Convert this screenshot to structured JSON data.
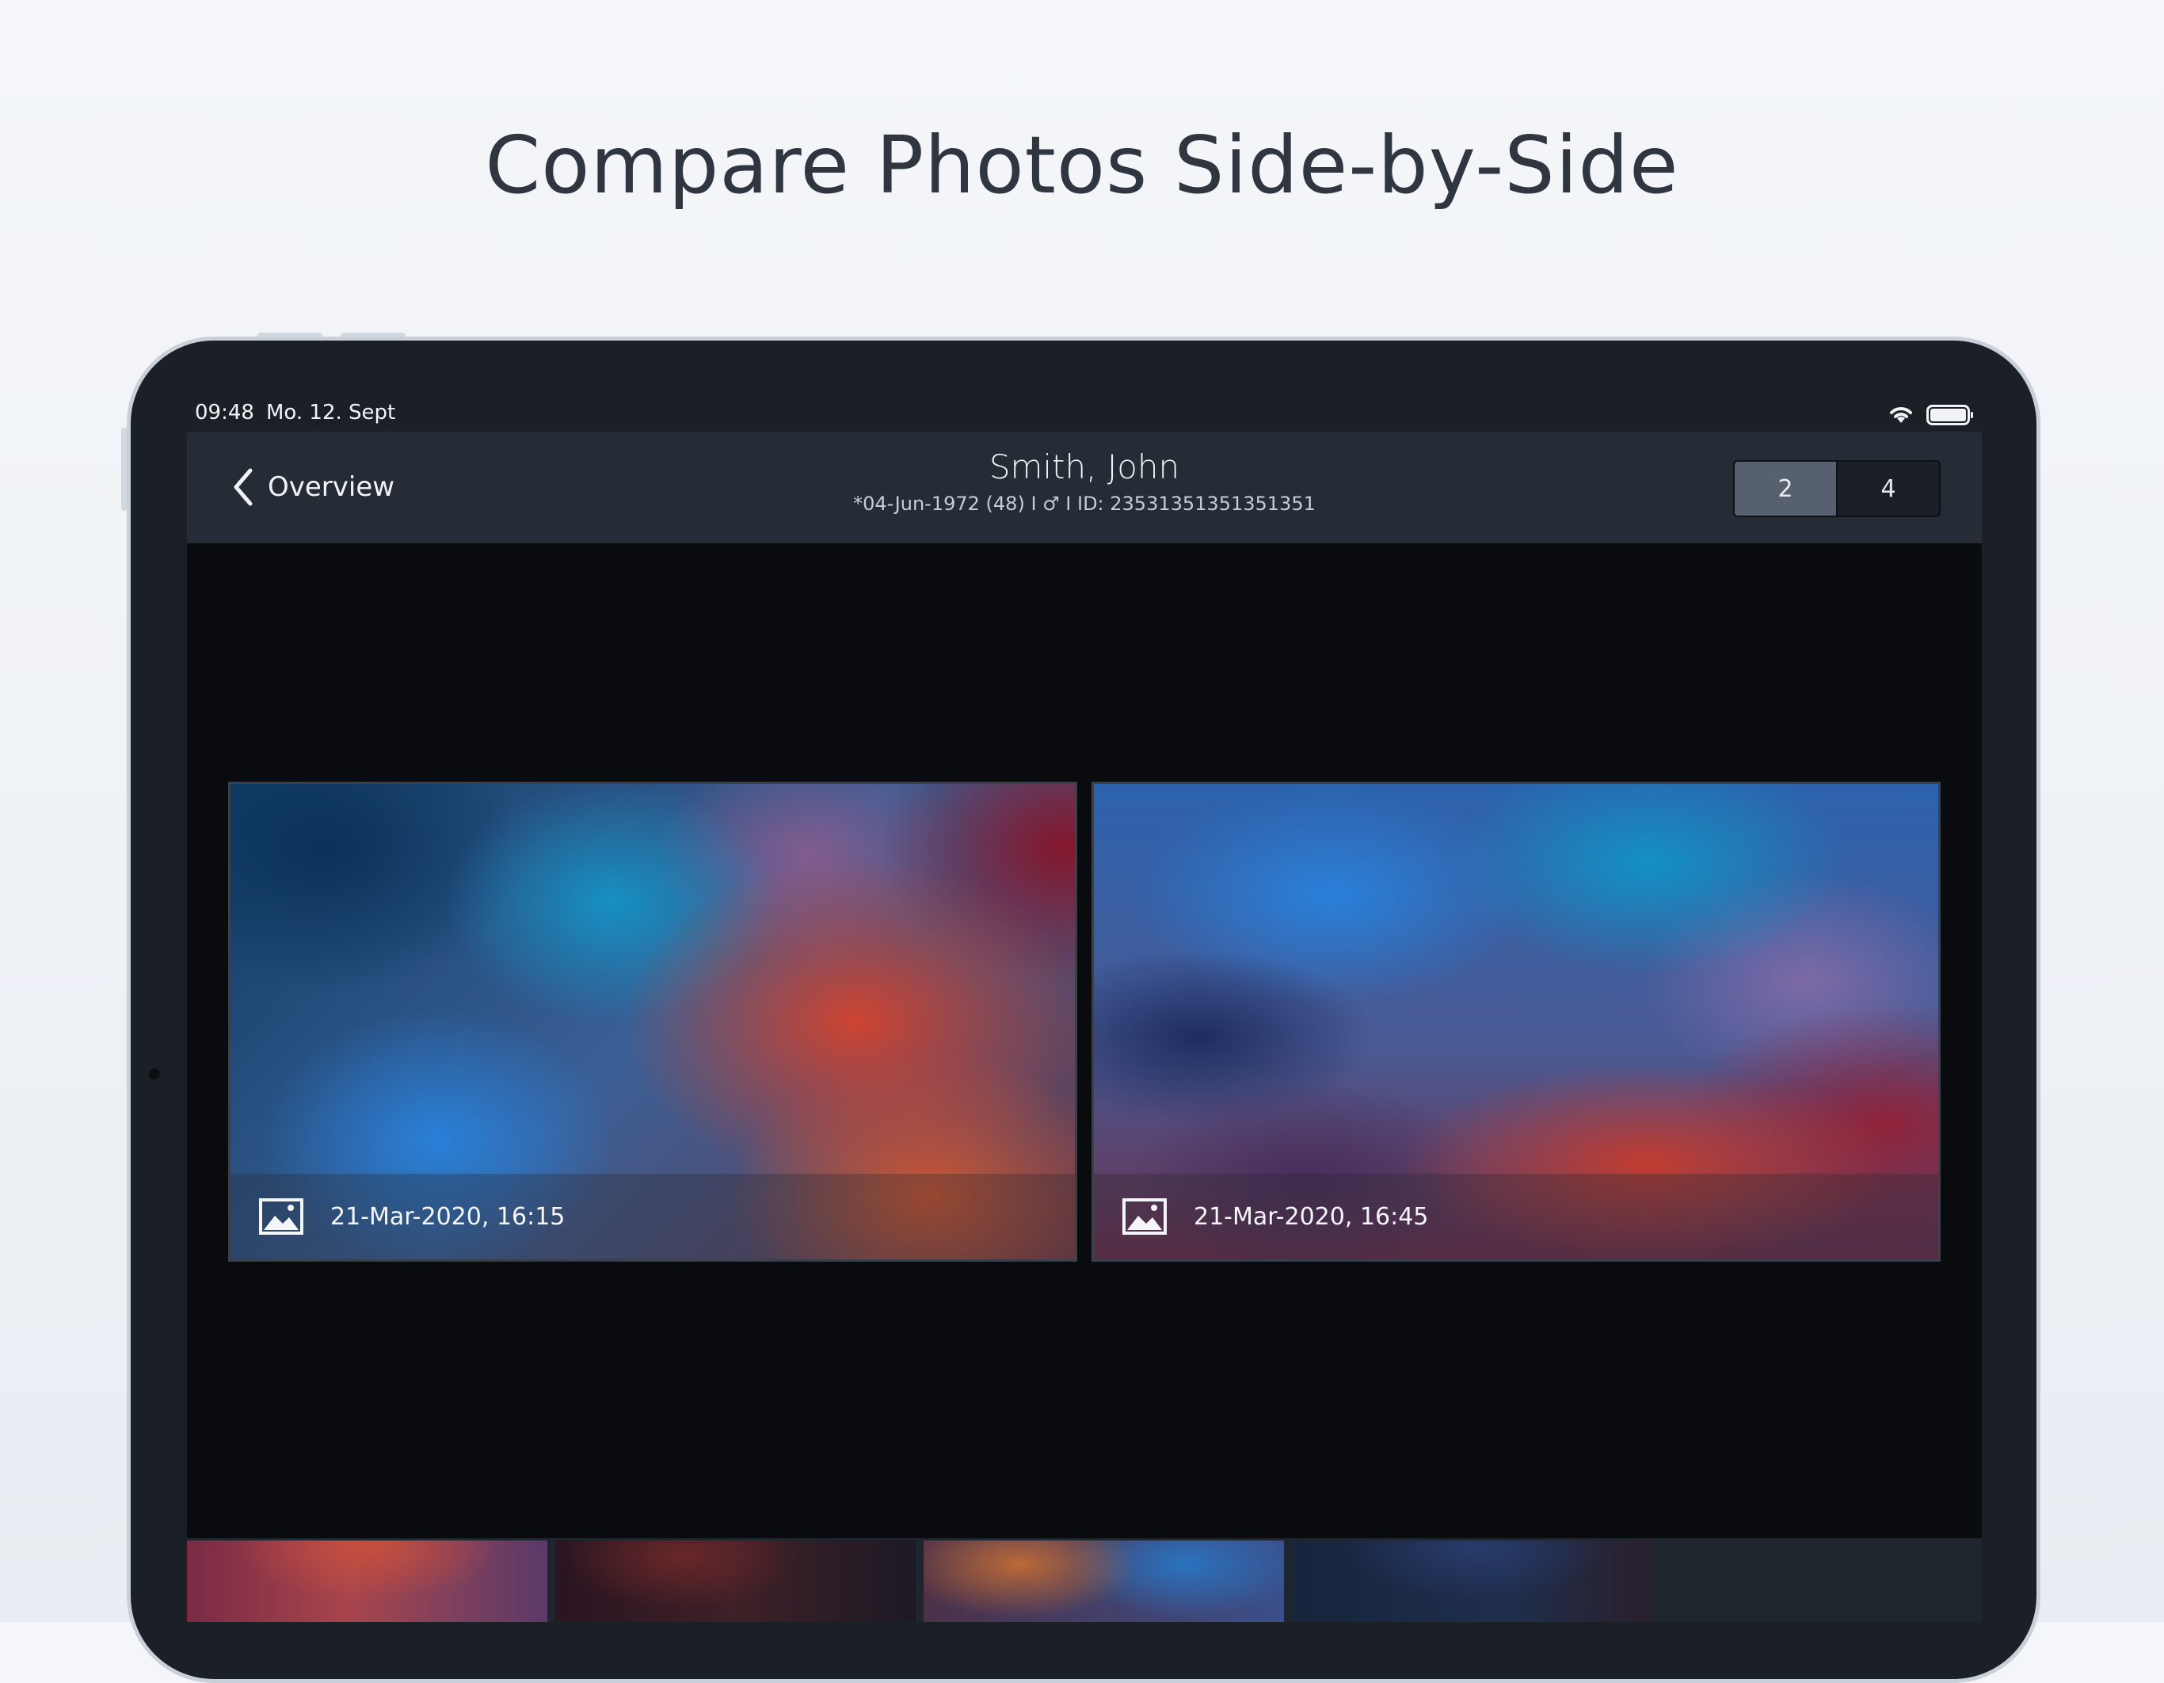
{
  "headline": "Compare Photos Side-by-Side",
  "status_bar": {
    "time": "09:48",
    "date": "Mo. 12. Sept",
    "icons": [
      "wifi-icon",
      "battery-icon"
    ]
  },
  "nav": {
    "back_label": "Overview",
    "back_icon": "chevron-left-icon",
    "patient_name": "Smith, John",
    "patient_meta": "*04-Jun-1972 (48)  I ♂ I  ID: 23531351351351351",
    "layout_options": [
      {
        "label": "2",
        "selected": true
      },
      {
        "label": "4",
        "selected": false
      }
    ]
  },
  "photos": [
    {
      "icon": "image-icon",
      "timestamp": "21-Mar-2020, 16:15"
    },
    {
      "icon": "image-icon",
      "timestamp": "21-Mar-2020, 16:45"
    }
  ],
  "colors": {
    "background": "#f4f6f9",
    "device_frame": "#1b2027",
    "navbar": "#262c35",
    "content": "#090b0f",
    "segment_active": "#56606e"
  }
}
